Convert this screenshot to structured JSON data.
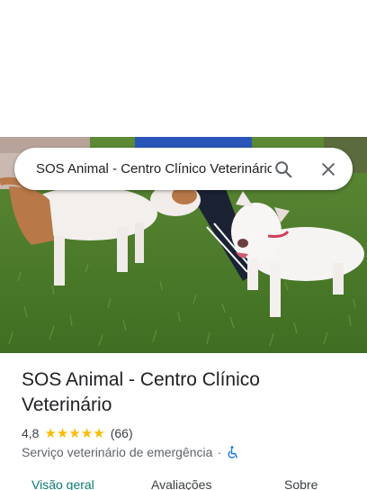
{
  "search": {
    "query": "SOS Animal - Centro Clínico Veterinário"
  },
  "place": {
    "name": "SOS Animal - Centro Clínico Veterinário",
    "rating": "4,8",
    "stars_filled": 5,
    "review_count": "(66)",
    "category": "Serviço veterinário de emergência",
    "separator": "·"
  },
  "tabs": [
    {
      "label": "Visão geral",
      "active": true
    },
    {
      "label": "Avaliações",
      "active": false
    },
    {
      "label": "Sobre",
      "active": false
    }
  ],
  "icons": {
    "search": "search-icon",
    "close": "close-icon",
    "accessibility": "wheelchair-icon",
    "star": "star-icon"
  },
  "colors": {
    "star": "#fbbc04",
    "active_tab": "#0b7a75",
    "accessibility": "#1a73e8"
  }
}
